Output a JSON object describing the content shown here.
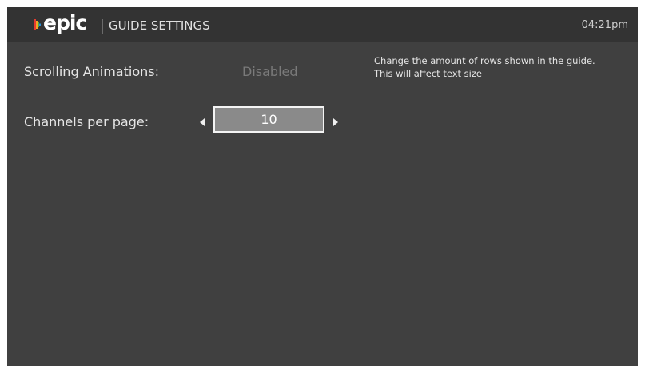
{
  "header": {
    "logo_text": "epic",
    "title": "GUIDE SETTINGS",
    "clock": "04:21pm"
  },
  "settings": [
    {
      "label": "Scrolling Animations:",
      "value": "Disabled"
    },
    {
      "label": "Channels per page:",
      "value": "10"
    }
  ],
  "help": {
    "line1": "Change the amount of rows shown in the guide.",
    "line2": "This will affect text size"
  },
  "colors": {
    "background": "#404040",
    "header": "#333333",
    "logo_mark": [
      "#e63b2e",
      "#f2a623",
      "#3fae49",
      "#2a8fd6"
    ],
    "selected_box": "#8a8a8a"
  },
  "icons": {
    "decrease": "triangle-left-icon",
    "increase": "triangle-right-icon"
  }
}
